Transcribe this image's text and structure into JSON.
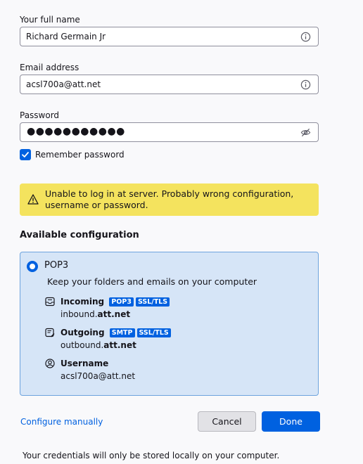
{
  "form": {
    "name_label": "Your full name",
    "name_value": "Richard Germain Jr",
    "email_label": "Email address",
    "email_value": "acsl700a@att.net",
    "password_label": "Password",
    "password_dots": "●●●●●●●●●●●",
    "remember_label": "Remember password",
    "remember_checked": true
  },
  "warning": {
    "text": "Unable to log in at server. Probably wrong configuration, username or password."
  },
  "config": {
    "section_title": "Available configuration",
    "option_label": "POP3",
    "option_desc": "Keep your folders and emails on your computer",
    "incoming": {
      "title": "Incoming",
      "badges": [
        "POP3",
        "SSL/TLS"
      ],
      "host_prefix": "inbound.",
      "host_domain": "att.net"
    },
    "outgoing": {
      "title": "Outgoing",
      "badges": [
        "SMTP",
        "SSL/TLS"
      ],
      "host_prefix": "outbound.",
      "host_domain": "att.net"
    },
    "username": {
      "title": "Username",
      "value": "acsl700a@att.net"
    }
  },
  "actions": {
    "configure_manually": "Configure manually",
    "cancel": "Cancel",
    "done": "Done"
  },
  "footer": {
    "note": "Your credentials will only be stored locally on your computer."
  },
  "colors": {
    "accent": "#0061e0",
    "warning_bg": "#f4e35e",
    "config_bg": "#d6e5f7"
  }
}
